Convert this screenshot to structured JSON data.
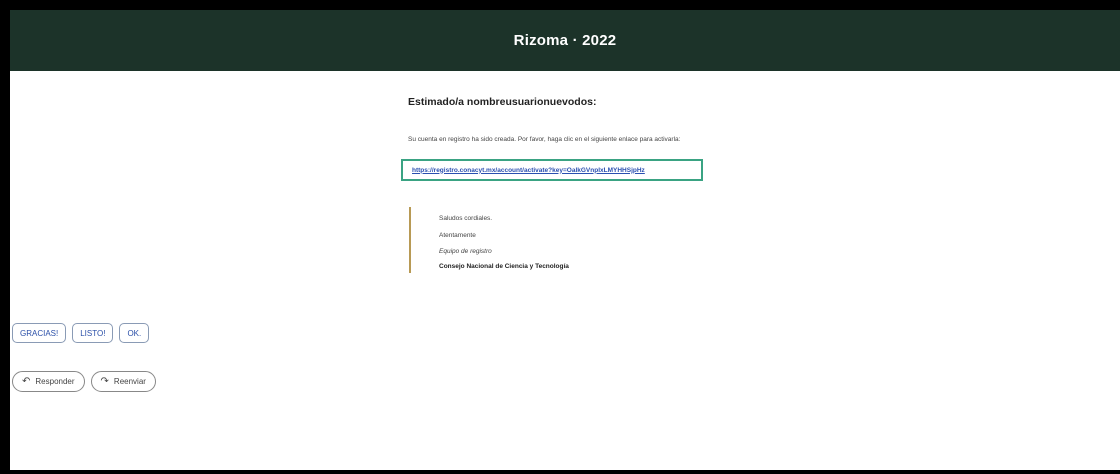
{
  "banner": {
    "title": "Rizoma · 2022"
  },
  "email": {
    "greeting": "Estimado/a nombreusuarionuevodos:",
    "intro": "Su cuenta en registro ha sido creada. Por favor, haga clic en el siguiente enlace para activarla:",
    "activation_link": "https://registro.conacyt.mx/account/activate?key=OalkGVnpIxLMYHHSjpHz",
    "signature": {
      "line1": "Saludos cordiales.",
      "line2": "Atentamente",
      "line3": "Equipo de registro",
      "line4": "Consejo Nacional de Ciencia y Tecnología"
    }
  },
  "quick_replies": [
    "GRACIAS!",
    "LISTO!",
    "OK."
  ],
  "actions": {
    "reply_label": "Responder",
    "reply_icon": "reply-arrow",
    "forward_label": "Reenviar",
    "forward_icon": "forward-arrow"
  },
  "colors": {
    "banner_bg": "#1c3329",
    "link_highlight": "#3aa383",
    "signature_bar": "#b89a55"
  }
}
